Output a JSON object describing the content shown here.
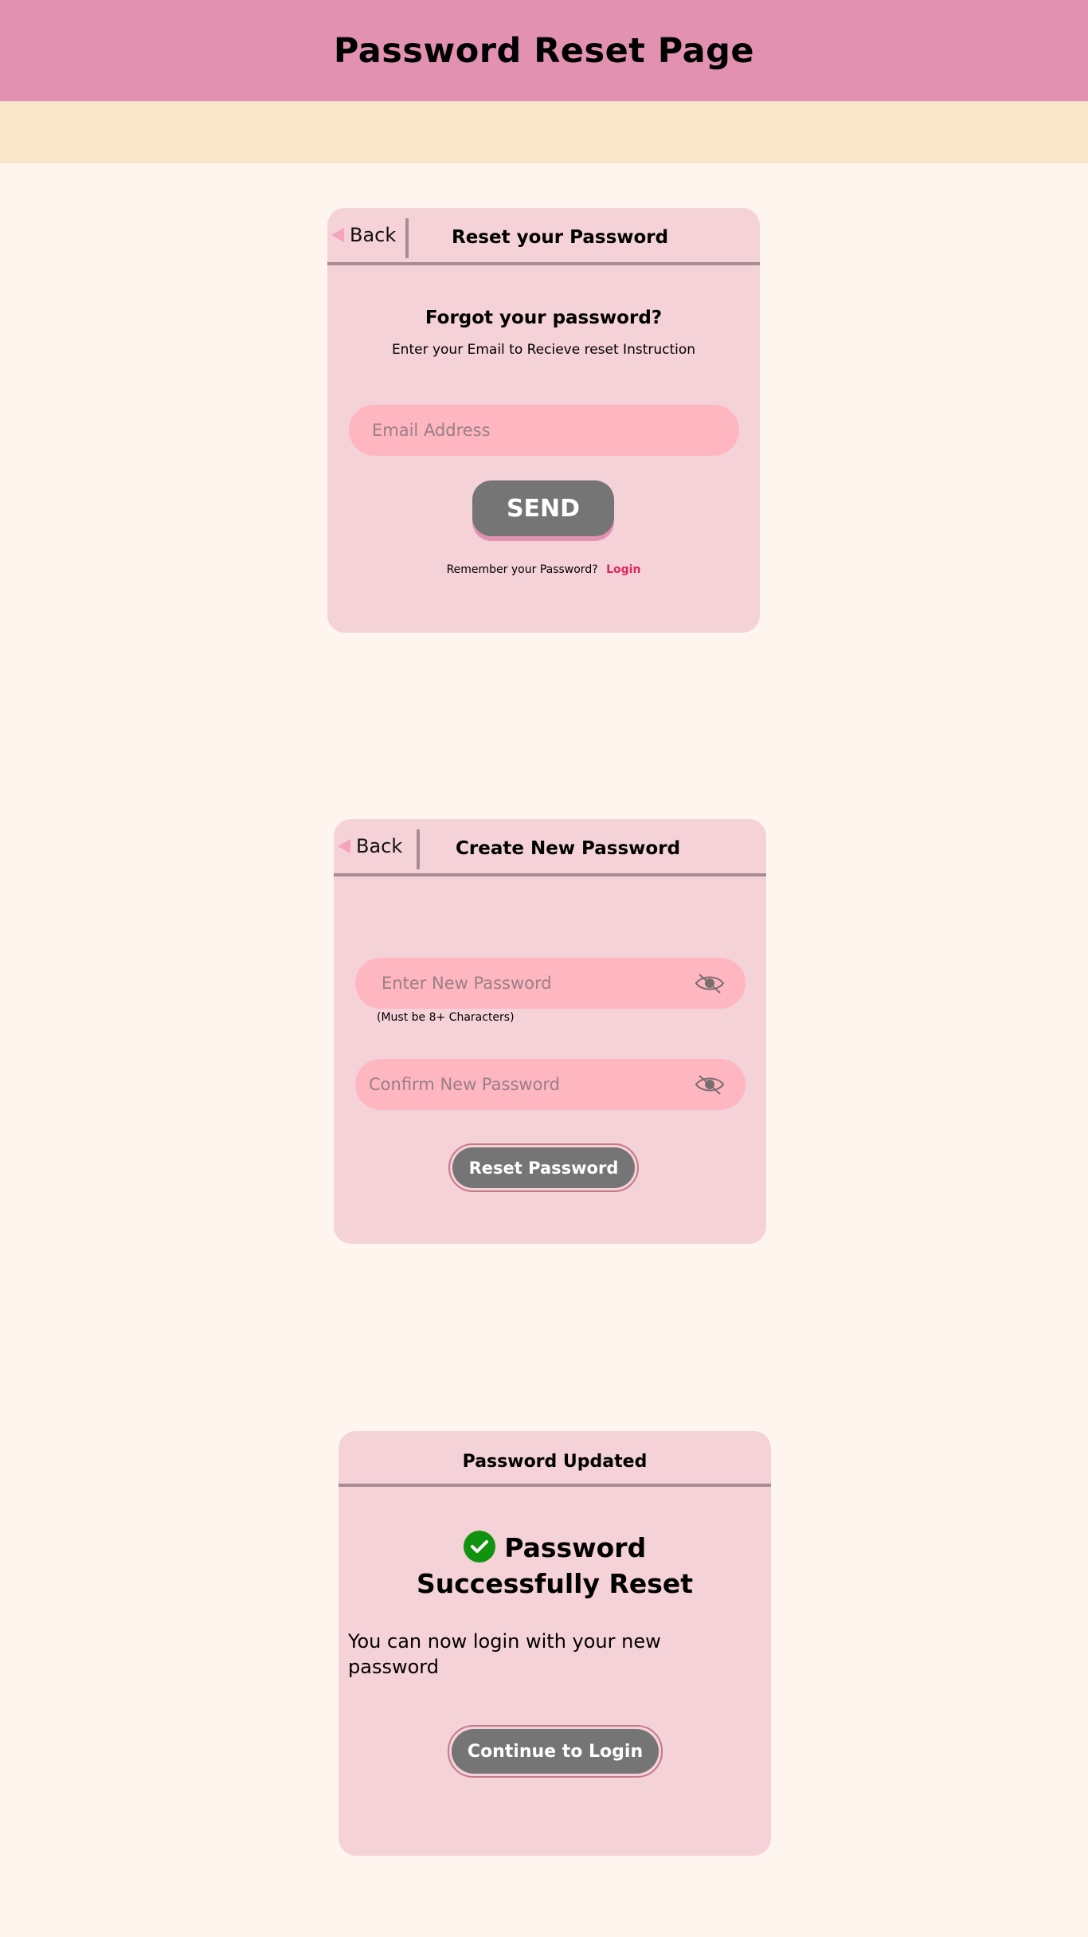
{
  "page": {
    "title": "Password Reset Page"
  },
  "reset_card": {
    "back_label": "Back",
    "title": "Reset your Password",
    "heading": "Forgot your password?",
    "instruction": "Enter your Email to Recieve reset Instruction",
    "email_placeholder": "Email Address",
    "send_label": "SEND",
    "remember_text": "Remember your Password?",
    "login_link": "Login"
  },
  "new_password_card": {
    "back_label": "Back",
    "title": "Create New Password",
    "new_password_placeholder": "Enter New Password",
    "hint": "(Must be 8+ Characters)",
    "confirm_password_placeholder": "Confirm New Password",
    "reset_label": "Reset Password"
  },
  "updated_card": {
    "title": "Password Updated",
    "success_line1": "Password",
    "success_line2": "Successfully Reset",
    "message": "You can now login with your new password",
    "continue_label": "Continue to Login"
  },
  "icons": {
    "back": "left-triangle-icon",
    "visibility": "eye-slash-icon",
    "success": "check-circle-icon"
  },
  "colors": {
    "header": "#e291b1",
    "sub_bar": "#f8e7ca",
    "background": "#fef5ee",
    "card": "#f5d1d8",
    "input": "#feb6c1",
    "button": "#757575",
    "link": "#e0245e",
    "success": "#12930f"
  }
}
